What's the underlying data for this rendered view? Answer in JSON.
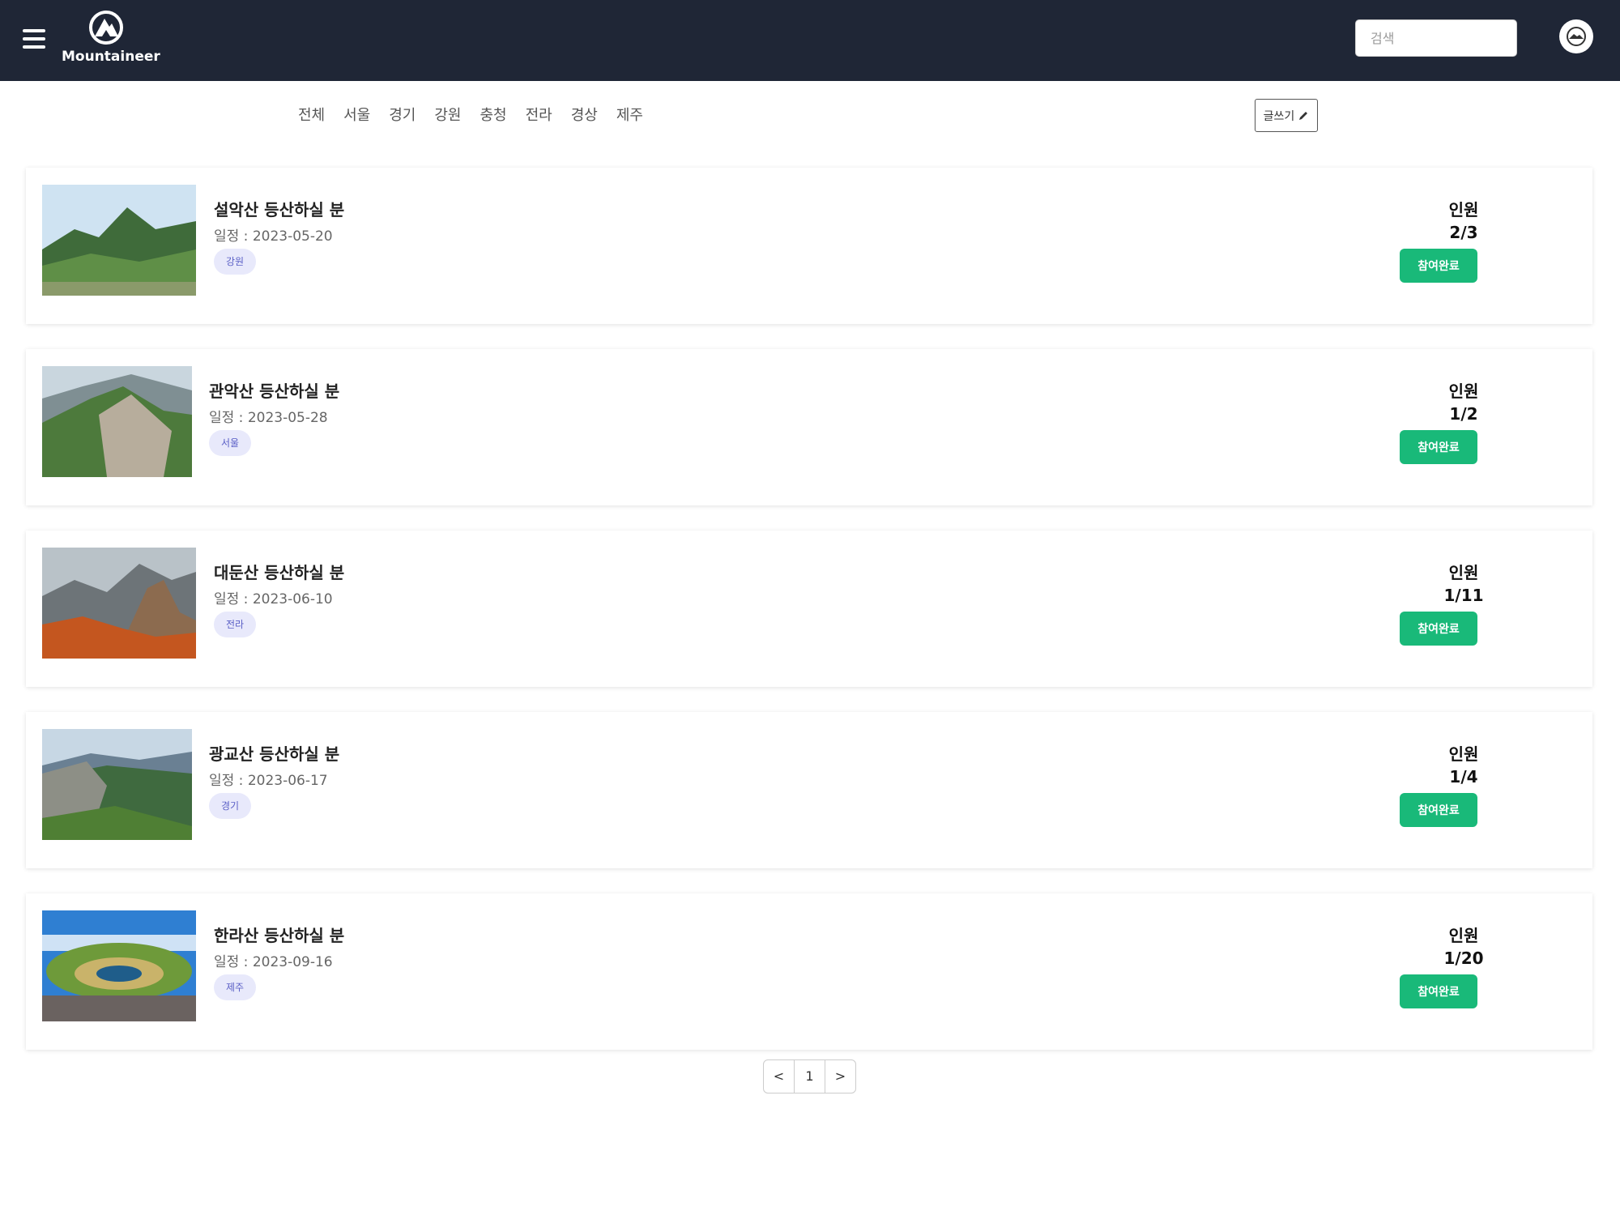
{
  "header": {
    "logo_text": "Mountaineer",
    "search_placeholder": "검색",
    "bg_color": "#1f2636"
  },
  "filters": [
    "전체",
    "서울",
    "경기",
    "강원",
    "충청",
    "전라",
    "경상",
    "제주"
  ],
  "write_button": "글쓰기",
  "posts": [
    {
      "title": "설악산 등산하실 분",
      "date": "일정 : 2023-05-20",
      "region": "강원",
      "people_label": "인원",
      "people_count": "2/3",
      "button": "참여완료"
    },
    {
      "title": "관악산 등산하실 분",
      "date": "일정 : 2023-05-28",
      "region": "서울",
      "people_label": "인원",
      "people_count": "1/2",
      "button": "참여완료"
    },
    {
      "title": "대둔산 등산하실 분",
      "date": "일정 : 2023-06-10",
      "region": "전라",
      "people_label": "인원",
      "people_count": "1/11",
      "button": "참여완료"
    },
    {
      "title": "광교산 등산하실 분",
      "date": "일정 : 2023-06-17",
      "region": "경기",
      "people_label": "인원",
      "people_count": "1/4",
      "button": "참여완료"
    },
    {
      "title": "한라산 등산하실 분",
      "date": "일정 : 2023-09-16",
      "region": "제주",
      "people_label": "인원",
      "people_count": "1/20",
      "button": "참여완료"
    }
  ],
  "pagination": {
    "prev": "<",
    "current": "1",
    "next": ">"
  },
  "colors": {
    "accent": "#19b979",
    "badge_bg": "#e8e9fb",
    "badge_text": "#5a5fc6"
  }
}
